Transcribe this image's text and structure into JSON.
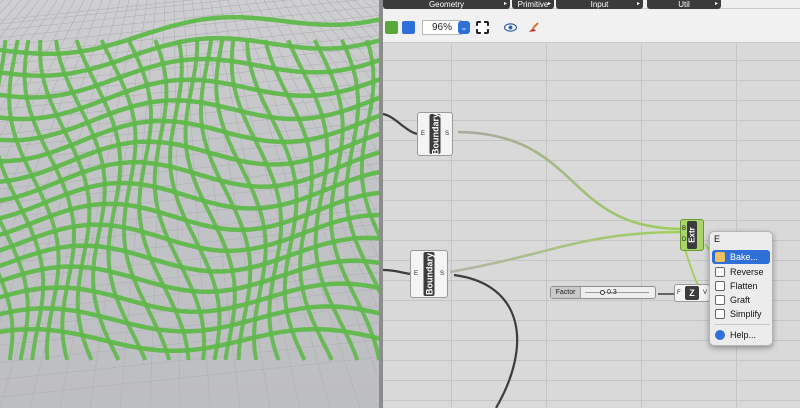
{
  "tabs": [
    {
      "label": "Geometry"
    },
    {
      "label": "Primitive"
    },
    {
      "label": "Input"
    },
    {
      "label": "Util"
    }
  ],
  "toolbar": {
    "zoom": "96%"
  },
  "nodes": {
    "boundary_top": {
      "title": "Boundary",
      "in_port": "E",
      "out_port": "S"
    },
    "boundary_bottom": {
      "title": "Boundary",
      "in_port": "E",
      "out_port": "S"
    },
    "extrude": {
      "title": "Extr",
      "in_ports": [
        "B",
        "D"
      ],
      "out_port": "E"
    },
    "z_vector": {
      "title": "Z",
      "in_port": "F",
      "out_port": "V"
    }
  },
  "slider": {
    "label": "Factor",
    "value": "0.3"
  },
  "context_menu": {
    "title": "E",
    "items": [
      {
        "label": "Bake...",
        "icon": "bake-icon",
        "selected": true
      },
      {
        "label": "Reverse",
        "icon": "reverse-icon"
      },
      {
        "label": "Flatten",
        "icon": "flatten-icon"
      },
      {
        "label": "Graft",
        "icon": "graft-icon"
      },
      {
        "label": "Simplify",
        "icon": "simplify-icon"
      },
      {
        "label": "Help...",
        "icon": "help-icon"
      }
    ]
  },
  "colors": {
    "geometry_green": "#5fb84a",
    "wire_dark": "#3d3d3d",
    "wire_green": "#9fd060",
    "selection_blue": "#2f6fd8"
  }
}
